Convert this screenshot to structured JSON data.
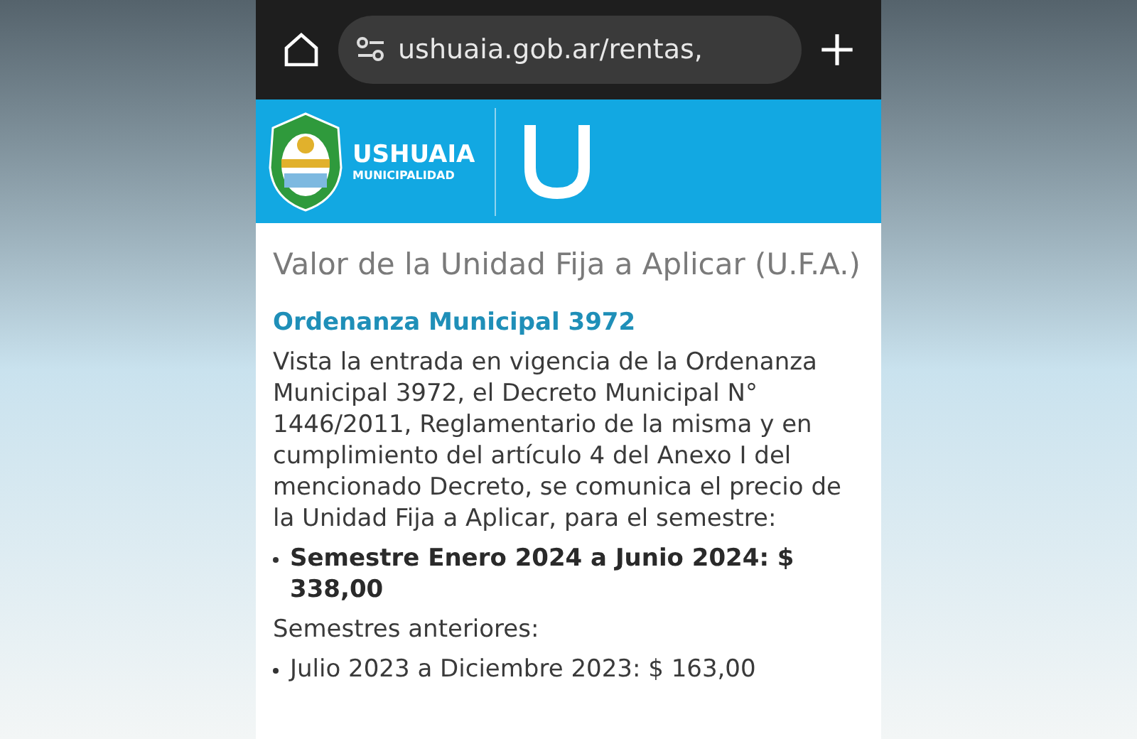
{
  "browser": {
    "url": "ushuaia.gob.ar/rentas,"
  },
  "header": {
    "brand": "USHUAIA",
    "subtitle": "MUNICIPALIDAD"
  },
  "page": {
    "title": "Valor de la Unidad Fija a Aplicar (U.F.A.)",
    "subtitle": "Ordenanza Municipal 3972",
    "paragraph": "Vista la entrada en vigencia de la Ordenanza Municipal 3972, el Decreto Municipal N° 1446/2011, Reglamentario de la misma y en cumplimiento del artículo 4 del Anexo I del mencionado Decreto, se comunica el precio de la Unidad Fija a Aplicar, para el semestre:",
    "current": [
      {
        "text": "Semestre Enero 2024 a Junio 2024: $ 338,00"
      }
    ],
    "previous_label": "Semestres anteriores:",
    "previous": [
      {
        "text": "Julio 2023 a Diciembre 2023: $ 163,00"
      }
    ]
  }
}
